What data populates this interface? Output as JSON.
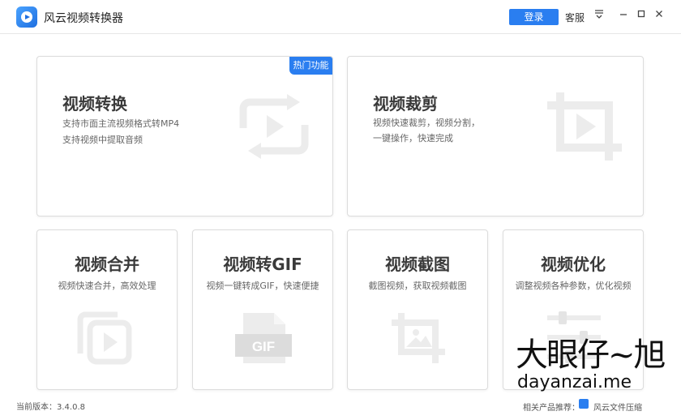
{
  "app": {
    "title": "风云视频转换器",
    "logo_icon": "app-play-logo-icon"
  },
  "header": {
    "login_label": "登录",
    "service_label": "客服"
  },
  "cards": [
    {
      "title": "视频转换",
      "badge": "热门功能",
      "desc_lines": [
        "支持市面主流视频格式转MP4",
        "支持视频中提取音频"
      ],
      "icon": "convert-icon"
    },
    {
      "title": "视频裁剪",
      "desc_lines": [
        "视频快速裁剪，视频分割，",
        "一键操作，快速完成"
      ],
      "icon": "crop-video-icon"
    },
    {
      "title": "视频合并",
      "desc": "视频快速合并，高效处理",
      "icon": "merge-icon"
    },
    {
      "title": "视频转GIF",
      "desc": "视频一键转成GIF，快速便捷",
      "icon": "gif-icon",
      "icon_text": "GIF"
    },
    {
      "title": "视频截图",
      "desc": "截图视频，获取视频截图",
      "icon": "screenshot-icon"
    },
    {
      "title": "视频优化",
      "desc": "调整视频各种参数，优化视频",
      "icon": "optimize-icon"
    }
  ],
  "footer": {
    "version": "当前版本：3.4.0.8",
    "related_label": "相关产品推荐：",
    "related_product": "风云文件压缩"
  },
  "watermark": {
    "chars": "大眼仔~旭",
    "url": "dayanzai.me"
  },
  "colors": {
    "accent": "#2a7ef0",
    "icon_gray": "#ececec"
  }
}
